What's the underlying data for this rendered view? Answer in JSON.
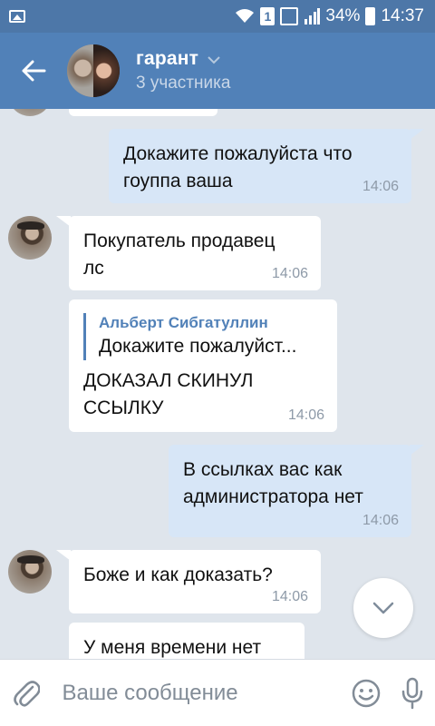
{
  "status_bar": {
    "battery": "34%",
    "time": "14:37",
    "sim_label": "1"
  },
  "header": {
    "title": "гарант",
    "subtitle": "3 участника"
  },
  "messages": [
    {
      "direction": "out",
      "text_lines": [
        "Докажите пожалуйста что",
        "гоуппа ваша"
      ],
      "time": "14:06"
    },
    {
      "direction": "in",
      "text_lines": [
        "Покупатель продавец",
        "лс"
      ],
      "time": "14:06"
    },
    {
      "direction": "in",
      "reply_to": {
        "author": "Альберт Сибгатуллин",
        "text": "Докажите пожалуйст..."
      },
      "text_lines": [
        "ДОКАЗАЛ СКИНУЛ",
        "ССЫЛКУ"
      ],
      "time": "14:06"
    },
    {
      "direction": "out",
      "text_lines": [
        "В ссылках вас как",
        "администратора нет"
      ],
      "time": "14:06"
    },
    {
      "direction": "in",
      "text_lines": [
        "Боже и как доказать?"
      ],
      "time": "14:06"
    },
    {
      "direction": "in",
      "text_lines": [
        "У меня времени нет"
      ],
      "time": ""
    }
  ],
  "input": {
    "placeholder": "Ваше сообщение"
  },
  "colors": {
    "header": "#5181b8",
    "status_bar": "#4d77a8",
    "outgoing_bubble": "#d7e6f7",
    "incoming_bubble": "#ffffff",
    "background": "#dfe5ec",
    "accent": "#5181b8"
  },
  "icons": {
    "back": "arrow-left-icon",
    "chevron": "chevron-down-icon",
    "scroll": "chevron-down-icon",
    "attach": "paperclip-icon",
    "emoji": "smiley-icon",
    "mic": "microphone-icon"
  }
}
